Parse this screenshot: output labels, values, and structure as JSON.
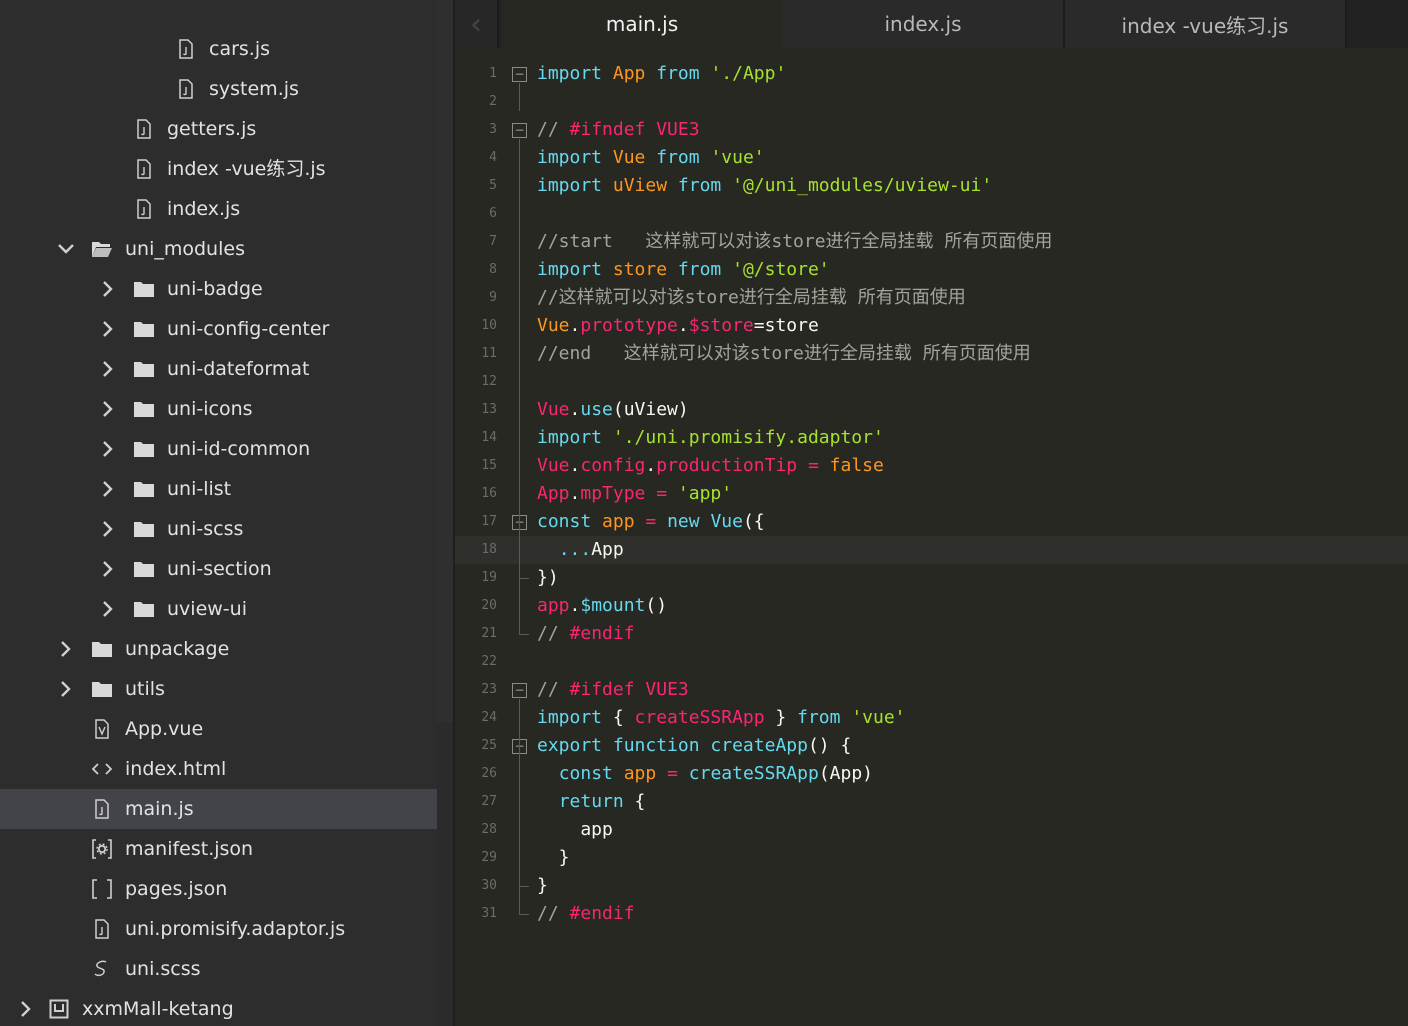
{
  "sidebar": {
    "items": [
      {
        "label": "cars.js",
        "icon": "js-file-icon",
        "type": "file"
      },
      {
        "label": "system.js",
        "icon": "js-file-icon",
        "type": "file"
      },
      {
        "label": "getters.js",
        "icon": "js-file-icon",
        "type": "file"
      },
      {
        "label": "index -vue练习.js",
        "icon": "js-file-icon",
        "type": "file"
      },
      {
        "label": "index.js",
        "icon": "js-file-icon",
        "type": "file"
      },
      {
        "label": "uni_modules",
        "icon": "folder-open-icon",
        "type": "folder",
        "expanded": true
      },
      {
        "label": "uni-badge",
        "icon": "folder-icon",
        "type": "folder"
      },
      {
        "label": "uni-config-center",
        "icon": "folder-icon",
        "type": "folder"
      },
      {
        "label": "uni-dateformat",
        "icon": "folder-icon",
        "type": "folder"
      },
      {
        "label": "uni-icons",
        "icon": "folder-icon",
        "type": "folder"
      },
      {
        "label": "uni-id-common",
        "icon": "folder-icon",
        "type": "folder"
      },
      {
        "label": "uni-list",
        "icon": "folder-icon",
        "type": "folder"
      },
      {
        "label": "uni-scss",
        "icon": "folder-icon",
        "type": "folder"
      },
      {
        "label": "uni-section",
        "icon": "folder-icon",
        "type": "folder"
      },
      {
        "label": "uview-ui",
        "icon": "folder-icon",
        "type": "folder"
      },
      {
        "label": "unpackage",
        "icon": "folder-icon",
        "type": "folder"
      },
      {
        "label": "utils",
        "icon": "folder-icon",
        "type": "folder"
      },
      {
        "label": "App.vue",
        "icon": "vue-file-icon",
        "type": "file"
      },
      {
        "label": "index.html",
        "icon": "html-file-icon",
        "type": "file"
      },
      {
        "label": "main.js",
        "icon": "js-file-icon",
        "type": "file",
        "selected": true
      },
      {
        "label": "manifest.json",
        "icon": "manifest-file-icon",
        "type": "file"
      },
      {
        "label": "pages.json",
        "icon": "json-file-icon",
        "type": "file"
      },
      {
        "label": "uni.promisify.adaptor.js",
        "icon": "js-file-icon",
        "type": "file"
      },
      {
        "label": "uni.scss",
        "icon": "scss-file-icon",
        "type": "file"
      },
      {
        "label": "xxmMall-ketang",
        "icon": "project-icon",
        "type": "project"
      }
    ]
  },
  "tabs": [
    {
      "label": "main.js",
      "active": true
    },
    {
      "label": "index.js",
      "active": false
    },
    {
      "label": "index -vue练习.js",
      "active": false
    }
  ],
  "editor": {
    "current_line": 18,
    "lines": [
      {
        "n": "1",
        "tokens": [
          [
            "kw",
            "import"
          ],
          [
            "pu",
            " "
          ],
          [
            "obj",
            "App"
          ],
          [
            "pu",
            " "
          ],
          [
            "kw",
            "from"
          ],
          [
            "pu",
            " "
          ],
          [
            "st",
            "'./App'"
          ]
        ]
      },
      {
        "n": "2",
        "tokens": []
      },
      {
        "n": "3",
        "tokens": [
          [
            "cm",
            "// "
          ],
          [
            "cmk",
            "#ifndef"
          ],
          [
            "pu",
            " "
          ],
          [
            "cmk",
            "VUE3"
          ]
        ]
      },
      {
        "n": "4",
        "tokens": [
          [
            "kw",
            "import"
          ],
          [
            "pu",
            " "
          ],
          [
            "obj",
            "Vue"
          ],
          [
            "pu",
            " "
          ],
          [
            "kw",
            "from"
          ],
          [
            "pu",
            " "
          ],
          [
            "st",
            "'vue'"
          ]
        ]
      },
      {
        "n": "5",
        "tokens": [
          [
            "kw",
            "import"
          ],
          [
            "pu",
            " "
          ],
          [
            "obj",
            "uView"
          ],
          [
            "pu",
            " "
          ],
          [
            "kw",
            "from"
          ],
          [
            "pu",
            " "
          ],
          [
            "st",
            "'@/uni_modules/uview-ui'"
          ]
        ]
      },
      {
        "n": "6",
        "tokens": []
      },
      {
        "n": "7",
        "tokens": [
          [
            "cm",
            "//start   这样就可以对该store进行全局挂载 所有页面使用"
          ]
        ]
      },
      {
        "n": "8",
        "tokens": [
          [
            "kw",
            "import"
          ],
          [
            "pu",
            " "
          ],
          [
            "obj",
            "store"
          ],
          [
            "pu",
            " "
          ],
          [
            "kw",
            "from"
          ],
          [
            "pu",
            " "
          ],
          [
            "st",
            "'@/store'"
          ]
        ]
      },
      {
        "n": "9",
        "tokens": [
          [
            "cm",
            "//这样就可以对该store进行全局挂载 所有页面使用"
          ]
        ]
      },
      {
        "n": "10",
        "tokens": [
          [
            "lit",
            "Vue"
          ],
          [
            "pu",
            "."
          ],
          [
            "nm",
            "prototype"
          ],
          [
            "pu",
            "."
          ],
          [
            "nm",
            "$store"
          ],
          [
            "pu",
            "=store"
          ]
        ]
      },
      {
        "n": "11",
        "tokens": [
          [
            "cm",
            "//end   这样就可以对该store进行全局挂载 所有页面使用"
          ]
        ]
      },
      {
        "n": "12",
        "tokens": []
      },
      {
        "n": "13",
        "tokens": [
          [
            "nm",
            "Vue"
          ],
          [
            "pu",
            "."
          ],
          [
            "kw",
            "use"
          ],
          [
            "pu",
            "(uView)"
          ]
        ]
      },
      {
        "n": "14",
        "tokens": [
          [
            "kw",
            "import"
          ],
          [
            "pu",
            " "
          ],
          [
            "st",
            "'./uni.promisify.adaptor'"
          ]
        ]
      },
      {
        "n": "15",
        "tokens": [
          [
            "nm",
            "Vue"
          ],
          [
            "pu",
            "."
          ],
          [
            "nm",
            "config"
          ],
          [
            "pu",
            "."
          ],
          [
            "nm",
            "productionTip"
          ],
          [
            "pu",
            " "
          ],
          [
            "nm",
            "="
          ],
          [
            "pu",
            " "
          ],
          [
            "lit",
            "false"
          ]
        ]
      },
      {
        "n": "16",
        "tokens": [
          [
            "nm",
            "App"
          ],
          [
            "pu",
            "."
          ],
          [
            "nm",
            "mpType"
          ],
          [
            "pu",
            " "
          ],
          [
            "nm",
            "="
          ],
          [
            "pu",
            " "
          ],
          [
            "st",
            "'app'"
          ]
        ]
      },
      {
        "n": "17",
        "tokens": [
          [
            "kw",
            "const"
          ],
          [
            "pu",
            " "
          ],
          [
            "obj",
            "app"
          ],
          [
            "pu",
            " "
          ],
          [
            "nm",
            "="
          ],
          [
            "pu",
            " "
          ],
          [
            "kw",
            "new"
          ],
          [
            "pu",
            " "
          ],
          [
            "kw",
            "Vue"
          ],
          [
            "pu",
            "({"
          ]
        ]
      },
      {
        "n": "18",
        "tokens": [
          [
            "pu",
            "  "
          ],
          [
            "kw",
            "..."
          ],
          [
            "pu",
            "App"
          ]
        ]
      },
      {
        "n": "19",
        "tokens": [
          [
            "pu",
            "})"
          ]
        ]
      },
      {
        "n": "20",
        "tokens": [
          [
            "nm",
            "app"
          ],
          [
            "pu",
            "."
          ],
          [
            "kw",
            "$mount"
          ],
          [
            "pu",
            "()"
          ]
        ]
      },
      {
        "n": "21",
        "tokens": [
          [
            "cm",
            "// "
          ],
          [
            "cmk",
            "#endif"
          ]
        ]
      },
      {
        "n": "22",
        "tokens": []
      },
      {
        "n": "23",
        "tokens": [
          [
            "cm",
            "// "
          ],
          [
            "cmk",
            "#ifdef"
          ],
          [
            "pu",
            " "
          ],
          [
            "cmk",
            "VUE3"
          ]
        ]
      },
      {
        "n": "24",
        "tokens": [
          [
            "kw",
            "import"
          ],
          [
            "pu",
            " { "
          ],
          [
            "nm",
            "createSSRApp"
          ],
          [
            "pu",
            " } "
          ],
          [
            "kw",
            "from"
          ],
          [
            "pu",
            " "
          ],
          [
            "st",
            "'vue'"
          ]
        ]
      },
      {
        "n": "25",
        "tokens": [
          [
            "kw",
            "export"
          ],
          [
            "pu",
            " "
          ],
          [
            "kw",
            "function"
          ],
          [
            "pu",
            " "
          ],
          [
            "kw",
            "createApp"
          ],
          [
            "pu",
            "() {"
          ]
        ]
      },
      {
        "n": "26",
        "tokens": [
          [
            "pu",
            "  "
          ],
          [
            "kw",
            "const"
          ],
          [
            "pu",
            " "
          ],
          [
            "obj",
            "app"
          ],
          [
            "pu",
            " "
          ],
          [
            "nm",
            "="
          ],
          [
            "pu",
            " "
          ],
          [
            "kw",
            "createSSRApp"
          ],
          [
            "pu",
            "(App)"
          ]
        ]
      },
      {
        "n": "27",
        "tokens": [
          [
            "pu",
            "  "
          ],
          [
            "kw",
            "return"
          ],
          [
            "pu",
            " {"
          ]
        ]
      },
      {
        "n": "28",
        "tokens": [
          [
            "pu",
            "    app"
          ]
        ]
      },
      {
        "n": "29",
        "tokens": [
          [
            "pu",
            "  }"
          ]
        ]
      },
      {
        "n": "30",
        "tokens": [
          [
            "pu",
            "}"
          ]
        ]
      },
      {
        "n": "31",
        "tokens": [
          [
            "cm",
            "// "
          ],
          [
            "cmk",
            "#endif"
          ]
        ]
      }
    ]
  }
}
